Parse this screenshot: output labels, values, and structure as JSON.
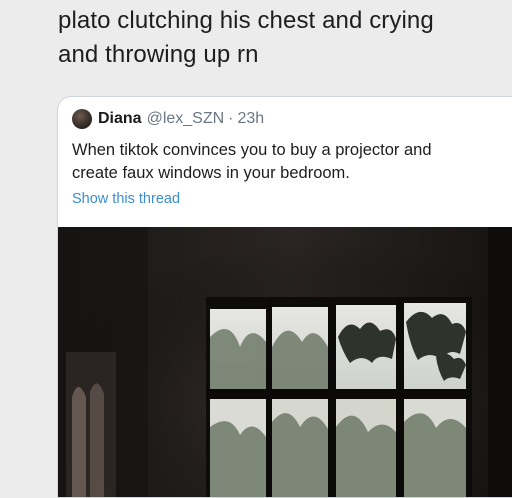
{
  "tweet": {
    "text_line1": "plato clutching his chest and crying",
    "text_line2": "and throwing up rn"
  },
  "quoted_tweet": {
    "author_name": "Diana",
    "author_handle": "@lex_SZN",
    "separator": "·",
    "time": "23h",
    "body_line1": "When tiktok convinces you to buy a projector and",
    "body_line2": "create faux windows in your bedroom.",
    "show_thread_label": "Show this thread"
  },
  "colors": {
    "link": "#3a8fd0",
    "muted": "#6b7782",
    "card_border": "#cfd6db"
  },
  "icons": {
    "avatar": "profile-avatar"
  }
}
